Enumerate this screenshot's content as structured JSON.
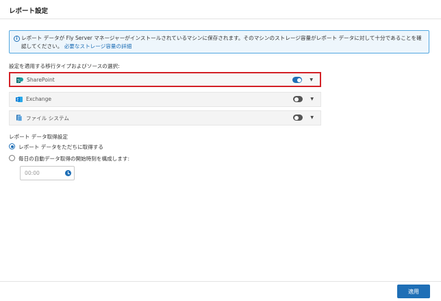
{
  "header": {
    "title": "レポート設定"
  },
  "info": {
    "text": "レポート データが Fly Server マネージャーがインストールされているマシンに保存されます。そのマシンのストレージ容量がレポート データに対して十分であることを確認してください。",
    "link_label": "必要なストレージ容量の詳細"
  },
  "sources": {
    "heading": "設定を適用する移行タイプおよびソースの選択:",
    "items": [
      {
        "label": "SharePoint",
        "enabled": true,
        "icon": "sharepoint-icon"
      },
      {
        "label": "Exchange",
        "enabled": false,
        "icon": "exchange-icon"
      },
      {
        "label": "ファイル システム",
        "enabled": false,
        "icon": "file-system-icon"
      }
    ]
  },
  "retrieval": {
    "heading": "レポート データ取得設定",
    "options": [
      {
        "label": "レポート データをただちに取得する",
        "selected": true
      },
      {
        "label": "毎日の自動データ取得の開始時刻を構成します:",
        "selected": false
      }
    ],
    "time_placeholder": "00:00"
  },
  "footer": {
    "apply_label": "適用"
  },
  "colors": {
    "accent": "#1f6fb6",
    "highlight": "#d32026"
  }
}
